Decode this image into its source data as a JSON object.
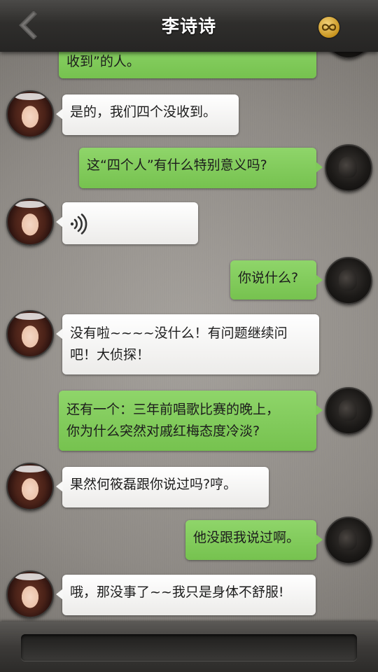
{
  "header": {
    "title": "李诗诗",
    "back_icon": "chevron-left-icon",
    "right_icon": "infinity-badge-icon",
    "accent_color": "#d4a332"
  },
  "messages": [
    {
      "side": "right",
      "text": "收到”的人。",
      "avatar": "user"
    },
    {
      "side": "left",
      "text": "是的，我们四个没收到。",
      "avatar": "li-shishi"
    },
    {
      "side": "right",
      "text": "这“四个人”有什么特别意义吗?",
      "avatar": "user"
    },
    {
      "side": "left",
      "type": "voice",
      "icon": "voice-wave-icon",
      "avatar": "li-shishi"
    },
    {
      "side": "right",
      "text": "你说什么?",
      "avatar": "user"
    },
    {
      "side": "left",
      "lines": [
        "没有啦~~~~没什么！有问题继续问",
        "吧！大侦探！"
      ],
      "avatar": "li-shishi"
    },
    {
      "side": "right",
      "lines": [
        "还有一个：三年前唱歌比赛的晚上，",
        "你为什么突然对戚红梅态度冷淡?"
      ],
      "avatar": "user"
    },
    {
      "side": "left",
      "text": "果然何筱磊跟你说过吗?哼。",
      "avatar": "li-shishi"
    },
    {
      "side": "right",
      "text": "他没跟我说过啊。",
      "avatar": "user"
    },
    {
      "side": "left",
      "text": "哦，那没事了~~我只是身体不舒服!",
      "avatar": "li-shishi"
    }
  ],
  "input": {
    "value": "",
    "placeholder": ""
  },
  "colors": {
    "right_bubble": "#80c95a",
    "left_bubble": "#f5f5f4",
    "topbar": "#2f2e2c"
  }
}
